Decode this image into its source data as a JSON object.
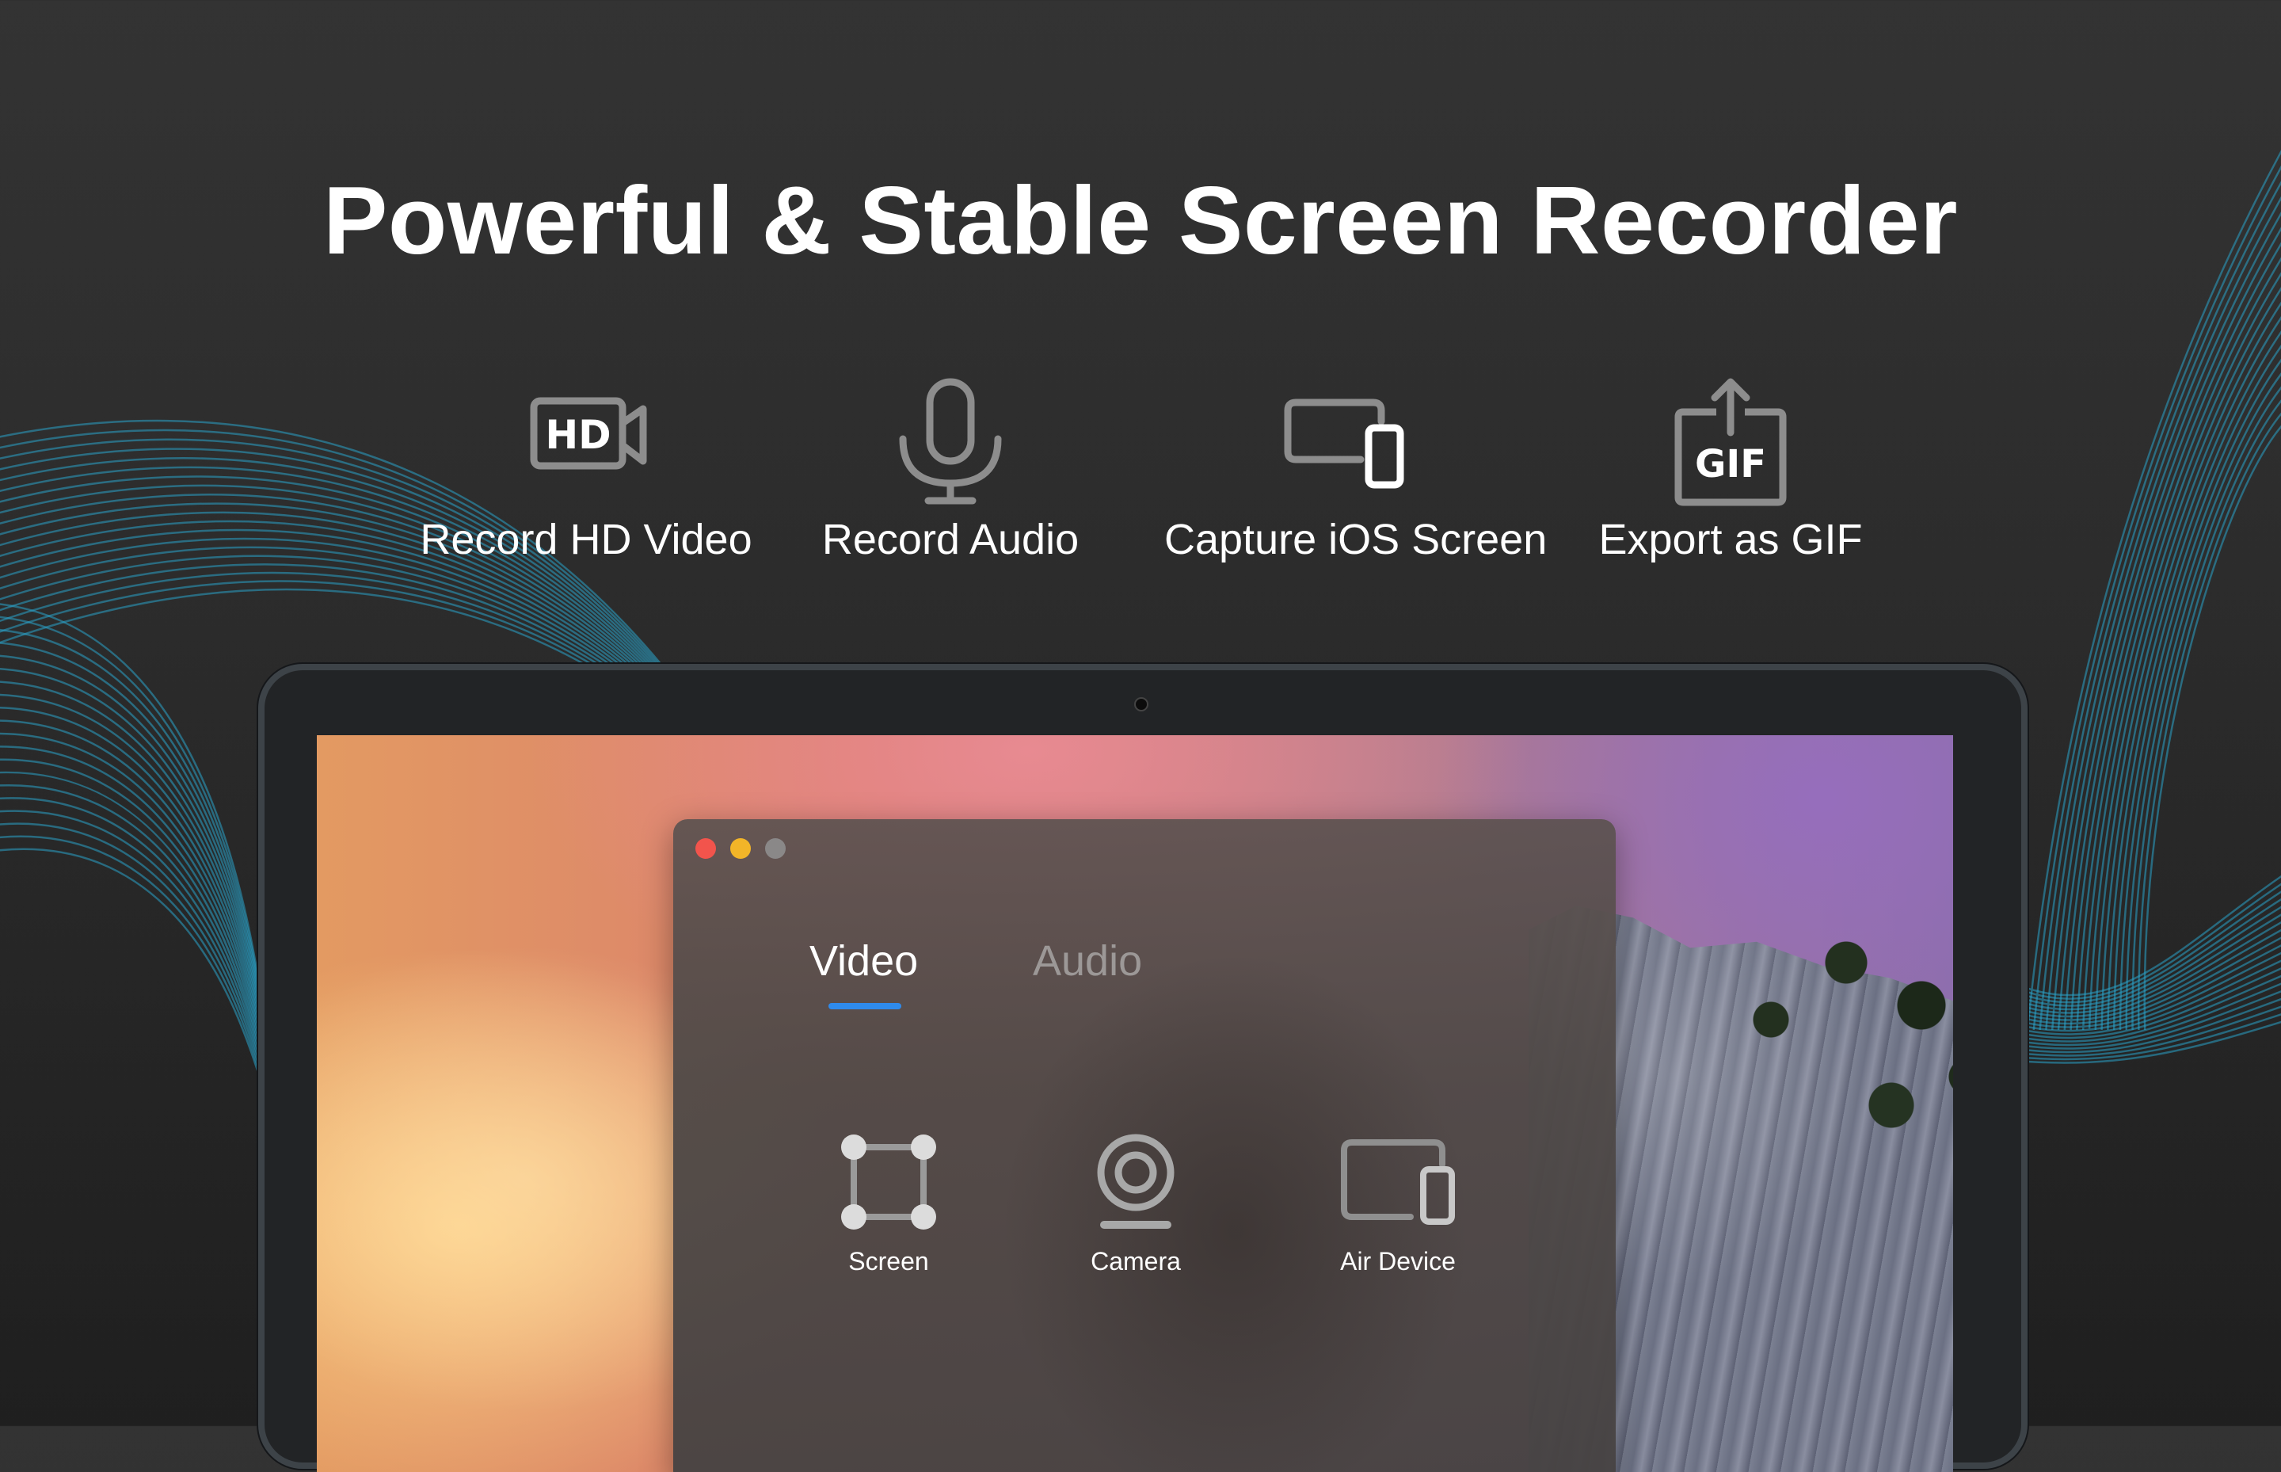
{
  "headline": "Powerful & Stable Screen Recorder",
  "features": [
    {
      "label": "Record HD Video",
      "icon": "hd-video-camera-icon",
      "icon_text": "HD"
    },
    {
      "label": "Record Audio",
      "icon": "microphone-icon"
    },
    {
      "label": "Capture iOS Screen",
      "icon": "devices-icon"
    },
    {
      "label": "Export as GIF",
      "icon": "gif-export-icon",
      "icon_text": "GIF"
    }
  ],
  "app": {
    "tabs": [
      {
        "label": "Video",
        "active": true
      },
      {
        "label": "Audio",
        "active": false
      }
    ],
    "modes": [
      {
        "label": "Screen",
        "icon": "screen-region-icon"
      },
      {
        "label": "Camera",
        "icon": "camera-icon"
      },
      {
        "label": "Air Device",
        "icon": "air-device-icon"
      }
    ]
  },
  "colors": {
    "accent": "#2f8bec",
    "wave": "#2aa3c9",
    "traffic_red": "#f2544c",
    "traffic_yellow": "#f2b528",
    "traffic_gray": "#8a8888"
  }
}
